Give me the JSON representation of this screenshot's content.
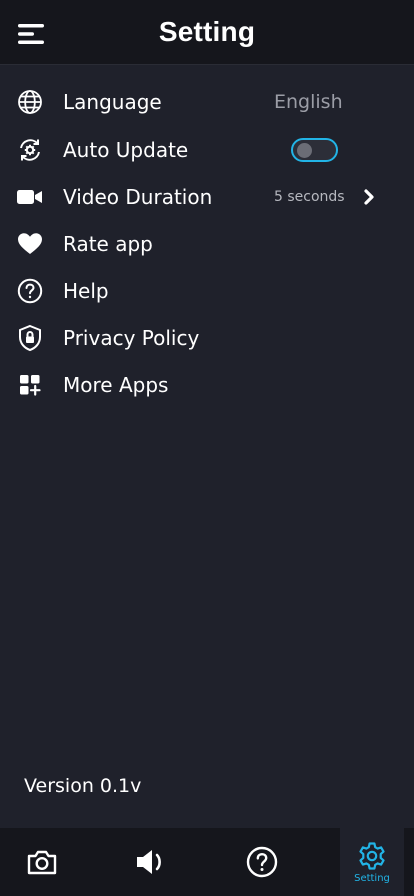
{
  "header": {
    "title": "Setting",
    "menu_icon": "hamburger-menu-icon"
  },
  "settings": {
    "language": {
      "label": "Language",
      "value": "English",
      "icon": "globe-icon"
    },
    "auto_update": {
      "label": "Auto Update",
      "toggle_on": false,
      "icon": "refresh-gear-icon"
    },
    "video_duration": {
      "label": "Video Duration",
      "value": "5 seconds",
      "icon": "video-camera-icon"
    },
    "rate_app": {
      "label": "Rate app",
      "icon": "heart-icon"
    },
    "help": {
      "label": "Help",
      "icon": "question-circle-icon"
    },
    "privacy_policy": {
      "label": "Privacy Policy",
      "icon": "shield-lock-icon"
    },
    "more_apps": {
      "label": "More Apps",
      "icon": "apps-grid-icon"
    }
  },
  "version": "Version 0.1v",
  "tabbar": {
    "tabs": [
      {
        "icon": "camera-icon",
        "label": ""
      },
      {
        "icon": "speaker-icon",
        "label": ""
      },
      {
        "icon": "question-circle-icon",
        "label": ""
      },
      {
        "icon": "gear-icon",
        "label": "Setting",
        "active": true
      }
    ]
  },
  "colors": {
    "background": "#1f212b",
    "header": "#15161c",
    "accent": "#22b4e6",
    "muted_text": "#9b9da6"
  }
}
